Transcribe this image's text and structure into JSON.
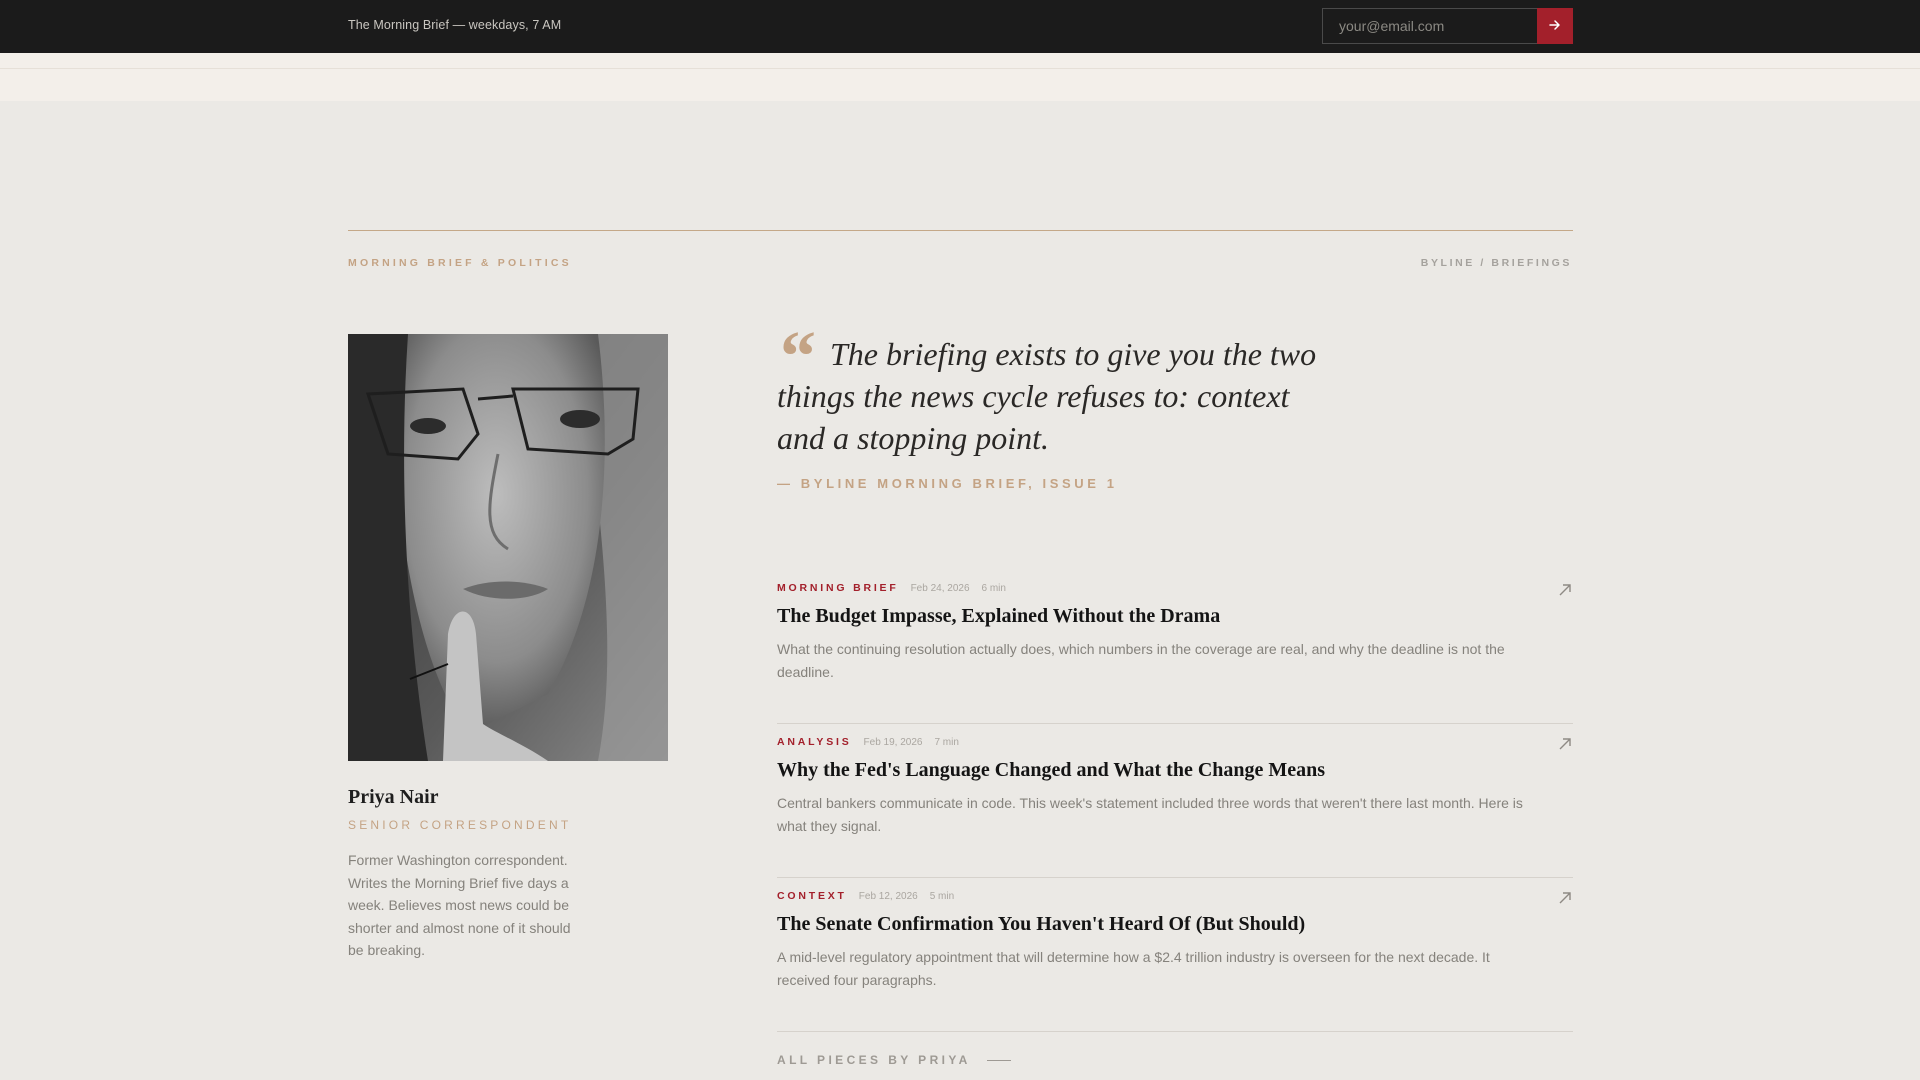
{
  "topbar": {
    "text": "The Morning Brief — weekdays, 7 AM",
    "email_placeholder": "your@email.com",
    "submit_icon": "arrow-right-icon",
    "accent": "#a3202b"
  },
  "header": {
    "section_label": "MORNING BRIEF & POLITICS",
    "breadcrumb": "BYLINE / BRIEFINGS"
  },
  "author": {
    "name": "Priya Nair",
    "role": "SENIOR CORRESPONDENT",
    "bio": "Former Washington correspondent. Writes the Morning Brief five days a week. Believes most news could be shorter and almost none of it should be breaking."
  },
  "quote": {
    "mark": "“",
    "text": "The briefing exists to give you the two things the news cycle refuses to: context and a stopping point.",
    "source": "— BYLINE MORNING BRIEF, ISSUE 1"
  },
  "articles": [
    {
      "tag": "MORNING BRIEF",
      "date": "Feb 24, 2026",
      "read_time": "6 min",
      "title": "The Budget Impasse, Explained Without the Drama",
      "excerpt": "What the continuing resolution actually does, which numbers in the coverage are real, and why the deadline is not the deadline.",
      "icon": "external-link-arrow-icon"
    },
    {
      "tag": "ANALYSIS",
      "date": "Feb 19, 2026",
      "read_time": "7 min",
      "title": "Why the Fed's Language Changed and What the Change Means",
      "excerpt": "Central bankers communicate in code. This week's statement included three words that weren't there last month. Here is what they signal.",
      "icon": "external-link-arrow-icon"
    },
    {
      "tag": "CONTEXT",
      "date": "Feb 12, 2026",
      "read_time": "5 min",
      "title": "The Senate Confirmation You Haven't Heard Of (But Should)",
      "excerpt": "A mid-level regulatory appointment that will determine how a $2.4 trillion industry is overseen for the next decade. It received four paragraphs.",
      "icon": "external-link-arrow-icon"
    }
  ],
  "footer_link": {
    "label": "ALL PIECES BY PRIYA"
  }
}
